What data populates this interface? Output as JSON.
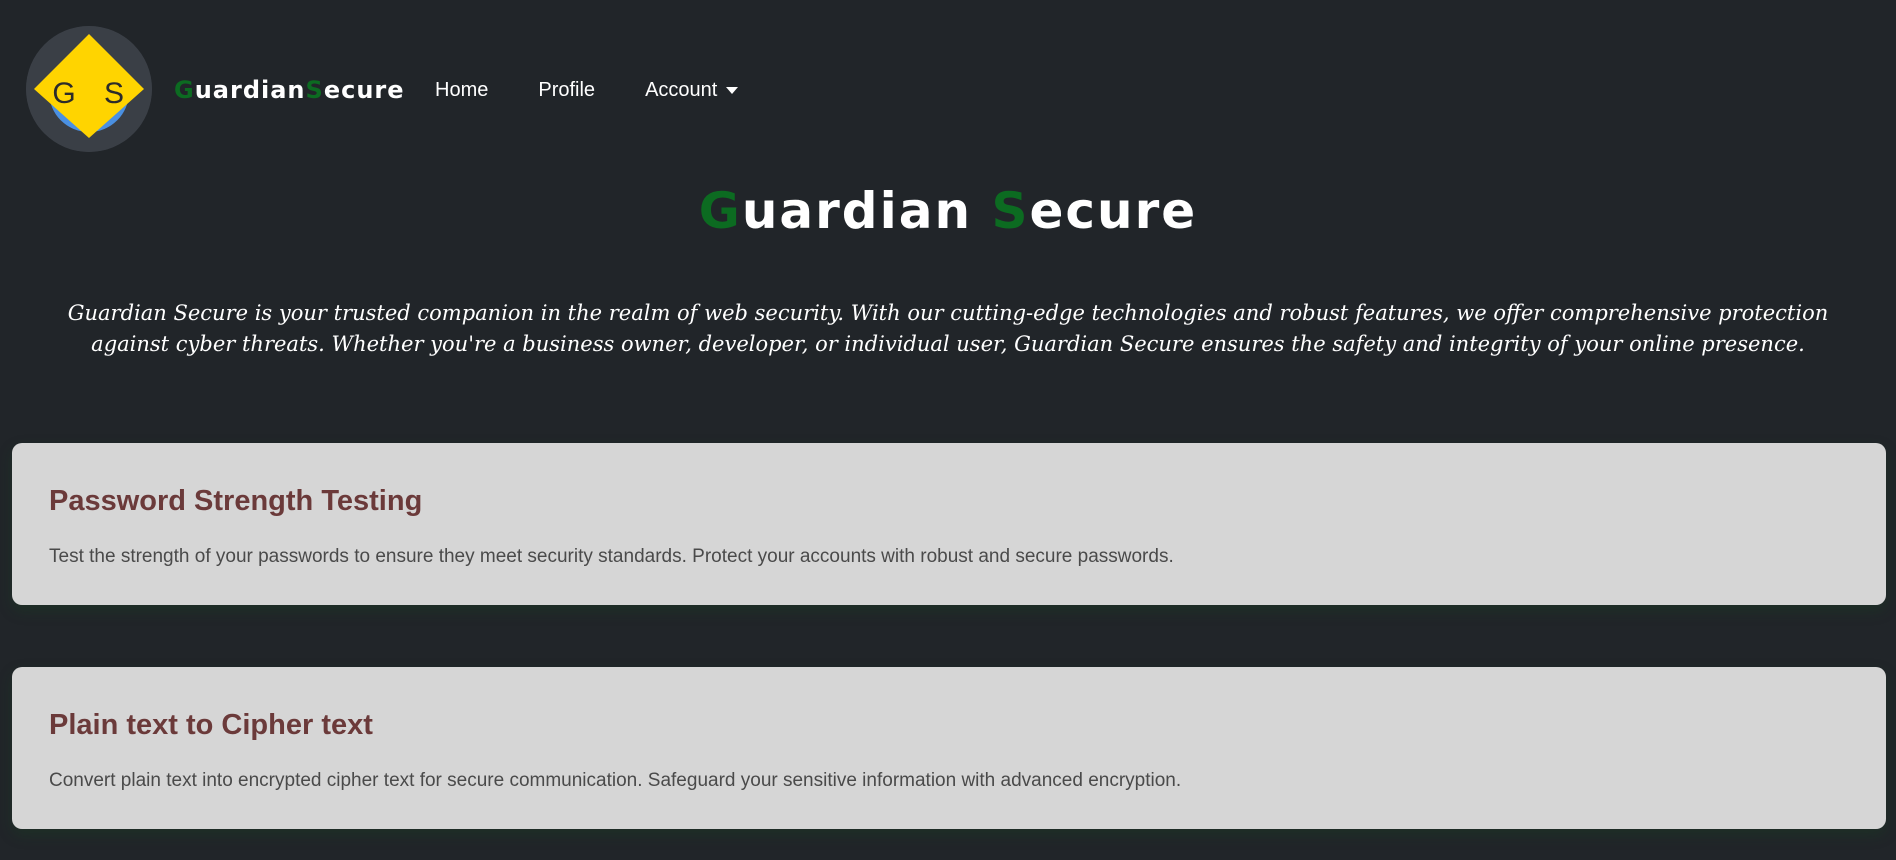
{
  "colors": {
    "background": "#212529",
    "brand_green": "#0c6b21",
    "card_background": "#d6d6d6",
    "card_title": "#6b3a3a",
    "logo_yellow": "#ffd400",
    "logo_blue": "#4a90e2"
  },
  "logo": {
    "letter_left": "G",
    "letter_right": "S"
  },
  "brand": {
    "part1_initial": "G",
    "part1_rest": "uardian",
    "part2_initial": "S",
    "part2_rest": "ecure"
  },
  "nav": {
    "home": "Home",
    "profile": "Profile",
    "account": "Account"
  },
  "hero": {
    "title_g": "G",
    "title_rest1": "uardian ",
    "title_s": "S",
    "title_rest2": "ecure",
    "description": "Guardian Secure is your trusted companion in the realm of web security. With our cutting-edge technologies and robust features, we offer comprehensive protection against cyber threats. Whether you're a business owner, developer, or individual user, Guardian Secure ensures the safety and integrity of your online presence."
  },
  "cards": [
    {
      "title": "Password Strength Testing",
      "text": "Test the strength of your passwords to ensure they meet security standards. Protect your accounts with robust and secure passwords."
    },
    {
      "title": "Plain text to Cipher text",
      "text": "Convert plain text into encrypted cipher text for secure communication. Safeguard your sensitive information with advanced encryption."
    }
  ]
}
